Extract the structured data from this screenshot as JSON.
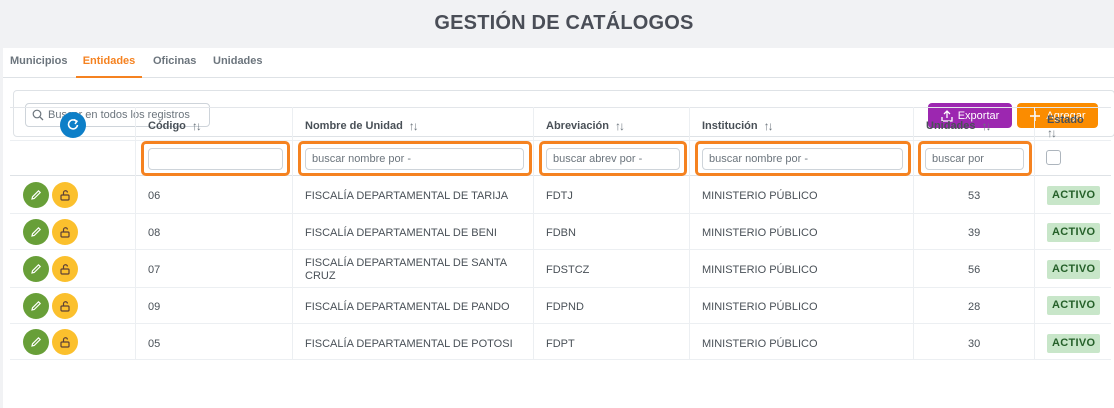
{
  "page": {
    "title": "GESTIÓN DE CATÁLOGOS"
  },
  "tabs": [
    {
      "label": "Municipios",
      "active": false
    },
    {
      "label": "Entidades",
      "active": true
    },
    {
      "label": "Oficinas",
      "active": false
    },
    {
      "label": "Unidades",
      "active": false
    }
  ],
  "toolbar": {
    "search_placeholder": "Buscar en todos los registros",
    "export_label": "Exportar",
    "add_label": "Agregar"
  },
  "columns": {
    "codigo": "Código",
    "nombre": "Nombre de Unidad",
    "abreviacion": "Abreviación",
    "institucion": "Institución",
    "unidades": "Unidades",
    "estado": "Estado"
  },
  "filters": {
    "codigo_value": "",
    "nombre_placeholder": "buscar nombre por -",
    "abreviacion_placeholder": "buscar abrev por -",
    "institucion_placeholder": "buscar nombre por -",
    "unidades_placeholder": "buscar por"
  },
  "rows": [
    {
      "codigo": "06",
      "nombre": "FISCALÍA DEPARTAMENTAL DE TARIJA",
      "abreviacion": "FDTJ",
      "institucion": "MINISTERIO PÚBLICO",
      "unidades": "53",
      "estado": "ACTIVO"
    },
    {
      "codigo": "08",
      "nombre": "FISCALÍA DEPARTAMENTAL DE BENI",
      "abreviacion": "FDBN",
      "institucion": "MINISTERIO PÚBLICO",
      "unidades": "39",
      "estado": "ACTIVO"
    },
    {
      "codigo": "07",
      "nombre": "FISCALÍA DEPARTAMENTAL DE SANTA",
      "nombre2": "CRUZ",
      "abreviacion": "FDSTCZ",
      "institucion": "MINISTERIO PÚBLICO",
      "unidades": "56",
      "estado": "ACTIVO"
    },
    {
      "codigo": "09",
      "nombre": "FISCALÍA DEPARTAMENTAL DE PANDO",
      "abreviacion": "FDPND",
      "institucion": "MINISTERIO PÚBLICO",
      "unidades": "28",
      "estado": "ACTIVO"
    },
    {
      "codigo": "05",
      "nombre": "FISCALÍA DEPARTAMENTAL DE POTOSI",
      "abreviacion": "FDPT",
      "institucion": "MINISTERIO PÚBLICO",
      "unidades": "30",
      "estado": "ACTIVO"
    }
  ],
  "colors": {
    "accent": "#f58220",
    "export": "#9c27b0",
    "add": "#fb8c00",
    "edit": "#689f38",
    "lock": "#fbc02d",
    "refresh": "#0d7fc8"
  }
}
